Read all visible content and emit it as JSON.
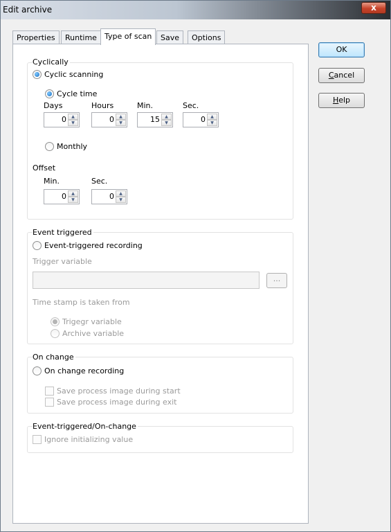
{
  "window": {
    "title": "Edit archive",
    "close_glyph": "x"
  },
  "tabs": [
    "Properties",
    "Runtime",
    "Type of scan",
    "Save",
    "Options"
  ],
  "buttons": {
    "ok": "OK",
    "cancel_u": "C",
    "cancel_rest": "ancel",
    "help_u": "H",
    "help_rest": "elp"
  },
  "cyclically": {
    "label": "Cyclically",
    "cyclic_scanning": "Cyclic scanning",
    "cycle_time": "Cycle time",
    "days_label": "Days",
    "hours_label": "Hours",
    "min_label": "Min.",
    "sec_label": "Sec.",
    "days": "0",
    "hours": "0",
    "min": "15",
    "sec": "0",
    "monthly": "Monthly",
    "offset_label": "Offset",
    "offset_min_label": "Min.",
    "offset_sec_label": "Sec.",
    "offset_min": "0",
    "offset_sec": "0"
  },
  "event_triggered": {
    "label": "Event triggered",
    "recording": "Event-triggered recording",
    "trigger_variable_label": "Trigger variable",
    "trigger_variable_value": "",
    "browse": "...",
    "timestamp_label": "Time stamp is taken from",
    "trigger_variable_option": "Trigegr variable",
    "archive_variable_option": "Archive variable"
  },
  "on_change": {
    "label": "On change",
    "recording": "On change recording",
    "save_start": "Save process image during start",
    "save_exit": "Save process image during exit"
  },
  "event_on_change": {
    "label": "Event-triggered/On-change",
    "ignore_initial": "Ignore initializing value"
  }
}
